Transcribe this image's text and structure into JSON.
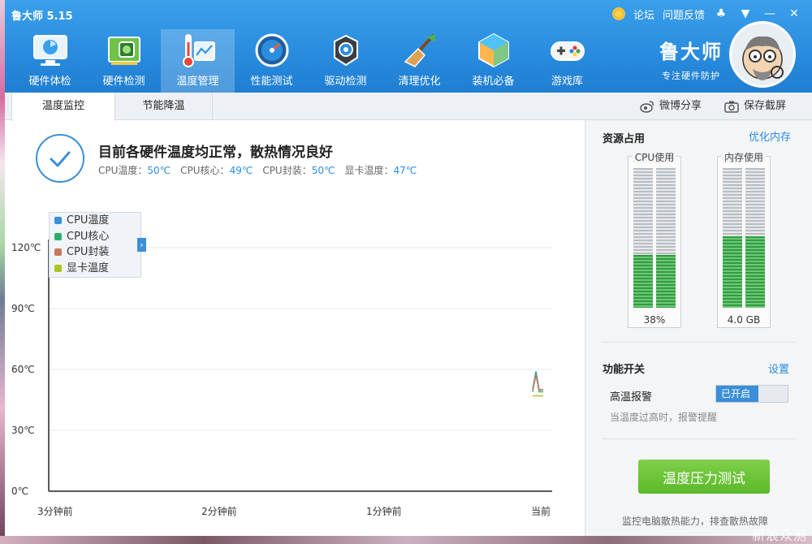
{
  "app": {
    "title": "鲁大师 5.15"
  },
  "titlebar": {
    "forum": "论坛",
    "feedback": "问题反馈"
  },
  "nav": [
    {
      "label": "硬件体检",
      "icon": "monitor-icon"
    },
    {
      "label": "硬件检测",
      "icon": "circuit-board-icon"
    },
    {
      "label": "温度管理",
      "icon": "thermometer-icon",
      "active": true
    },
    {
      "label": "性能测试",
      "icon": "speedometer-icon"
    },
    {
      "label": "驱动检测",
      "icon": "driver-gear-icon"
    },
    {
      "label": "清理优化",
      "icon": "broom-icon"
    },
    {
      "label": "装机必备",
      "icon": "box-icon"
    },
    {
      "label": "游戏库",
      "icon": "gamepad-icon"
    }
  ],
  "brand": {
    "name": "鲁大师",
    "slogan": "专注硬件防护"
  },
  "subtabs": {
    "temp_monitor": "温度监控",
    "power_saving": "节能降温"
  },
  "share": {
    "weibo": "微博分享",
    "screenshot": "保存截屏"
  },
  "status": {
    "title": "目前各硬件温度均正常，散热情况良好",
    "items": [
      {
        "label": "CPU温度：",
        "value": "50℃"
      },
      {
        "label": "CPU核心：",
        "value": "49℃"
      },
      {
        "label": "CPU封装：",
        "value": "50℃"
      },
      {
        "label": "显卡温度：",
        "value": "47℃"
      }
    ]
  },
  "legend": [
    {
      "label": "CPU温度",
      "color": "#3a8fd8"
    },
    {
      "label": "CPU核心",
      "color": "#2fae6a"
    },
    {
      "label": "CPU封装",
      "color": "#c8775a"
    },
    {
      "label": "显卡温度",
      "color": "#a8c81e"
    }
  ],
  "chart_data": {
    "type": "line",
    "y_ticks": [
      "120℃",
      "90℃",
      "60℃",
      "30℃",
      "0℃"
    ],
    "y_values": [
      120,
      90,
      60,
      30,
      0
    ],
    "ylim": [
      0,
      120
    ],
    "x_ticks": [
      "3分钟前",
      "2分钟前",
      "1分钟前",
      "当前"
    ],
    "grid": true,
    "series": [
      {
        "name": "CPU温度",
        "color": "#3a8fd8",
        "values": [
          50,
          59,
          50,
          50
        ]
      },
      {
        "name": "CPU核心",
        "color": "#2fae6a",
        "values": [
          49,
          58,
          49,
          49
        ]
      },
      {
        "name": "CPU封装",
        "color": "#c8775a",
        "values": [
          50,
          57,
          50,
          50
        ]
      },
      {
        "name": "显卡温度",
        "color": "#a8c81e",
        "values": [
          47,
          47,
          47,
          47
        ]
      }
    ]
  },
  "resources": {
    "title": "资源占用",
    "optimize": "优化内存",
    "cpu": {
      "label": "CPU使用",
      "value": "38%",
      "fraction": 0.38
    },
    "mem": {
      "label": "内存使用",
      "value": "4.0 GB",
      "fraction": 0.51
    }
  },
  "features": {
    "title": "功能开关",
    "settings": "设置",
    "alarm_label": "高温报警",
    "alarm_state": "已开启",
    "alarm_desc": "当温度过高时，报警提醒"
  },
  "stress": {
    "button": "温度压力测试",
    "footnote": "监控电脑散热能力，排查散热故障"
  },
  "watermark": "新浪众测"
}
